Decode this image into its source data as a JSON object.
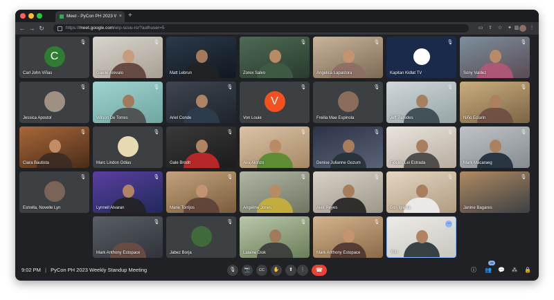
{
  "browser": {
    "tab_title": "Meet - PyCon PH 2023 W",
    "tab_close": "×",
    "new_tab": "+",
    "url_prefix": "https://",
    "url_domain": "meet.google.com",
    "url_path": "/erp-scuu-rcr?authuser=5"
  },
  "icons": {
    "back": "←",
    "forward": "→",
    "reload": "↻",
    "mic_off": "🎙",
    "more": "⋯",
    "meet_mic": "🎙",
    "meet_cam": "📷",
    "meet_cc": "CC",
    "meet_hand": "✋",
    "meet_present": "⬆",
    "meet_more": "⋮",
    "meet_end": "☎",
    "info": "ⓘ",
    "people": "👥",
    "chat": "💬",
    "activities": "⁂",
    "lock": "🔒"
  },
  "participants": [
    "Carl John Viñas",
    "Gaelle Arevalo",
    "Matt Lebrun",
    "Zorex Salvo",
    "Angelica Lapastora",
    "Kapitan Kidlat TV",
    "Sony Valdez",
    "Jessica Apostol",
    "Wilson De Torres",
    "Ariel Conde",
    "Von Louie",
    "Freilia Mae Espinola",
    "Jeff Paredes",
    "Niño Eclarin",
    "Ciara Bautista",
    "Marc Lindon Odias",
    "Gale Brodit",
    "Aira Alonzo",
    "Denise Julianne Gozum",
    "Fidelito Lei Estrada",
    "Mark Macaraeg",
    "Estrella, Novelle Lyn",
    "Lynnell Alvaran",
    "Marie Torrijos",
    "Angeline Jones",
    "Alex Reyes",
    "Bon Iglesia",
    "Janine Bagares",
    "Mark Anthony Estopace",
    "Jabez Borja",
    "Lalaine Diok",
    "Mark Anthony Estopace",
    "You"
  ],
  "letters": {
    "carl": "C",
    "von": "V"
  },
  "people_count": "33",
  "meeting": {
    "time": "9:02 PM",
    "separator": "|",
    "title": "PyCon PH 2023 Weekly Standup Meeting"
  },
  "colors": {
    "end_call": "#ea4335",
    "accent": "#8ab4f8",
    "avatar_green": "#2e7d32",
    "avatar_orange": "#f4511e"
  }
}
